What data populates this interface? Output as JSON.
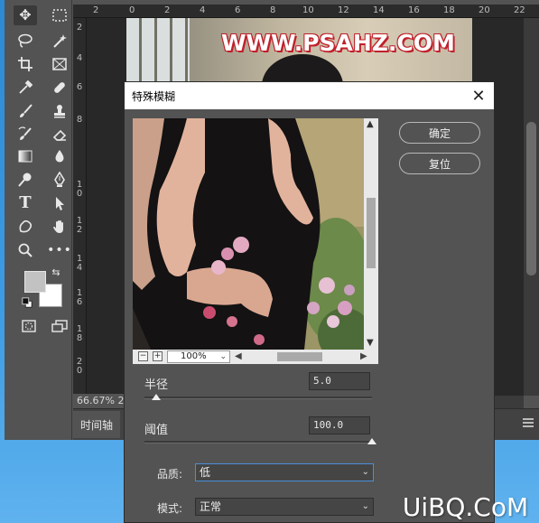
{
  "app": {
    "zoom_level": "66.67%",
    "zoom_level_suffix": "2"
  },
  "ruler_top": [
    "2",
    "0",
    "2",
    "4",
    "6",
    "8",
    "10",
    "12",
    "14",
    "16",
    "18",
    "20",
    "22"
  ],
  "ruler_left": [
    "2",
    "4",
    "6",
    "8",
    "1 0",
    "1 2",
    "1 4",
    "1 6",
    "1 8",
    "2 0"
  ],
  "canvas": {
    "watermark": "WWW.PSAHZ.COM"
  },
  "timeline": {
    "tab_label": "时间轴"
  },
  "dialog": {
    "title": "特殊模糊",
    "ok_label": "确定",
    "reset_label": "复位",
    "preview_zoom": "100%",
    "radius_label": "半径",
    "radius_value": "5.0",
    "radius_fraction": 0.05,
    "threshold_label": "阈值",
    "threshold_value": "100.0",
    "threshold_fraction": 1.0,
    "quality_label": "品质:",
    "quality_value": "低",
    "mode_label": "模式:",
    "mode_value": "正常"
  },
  "logo_text": "UiBQ.CoM",
  "colors": {
    "foreground": "#c2c2c2",
    "background": "#ffffff",
    "panel": "#535353",
    "focus": "#4a90d9"
  }
}
